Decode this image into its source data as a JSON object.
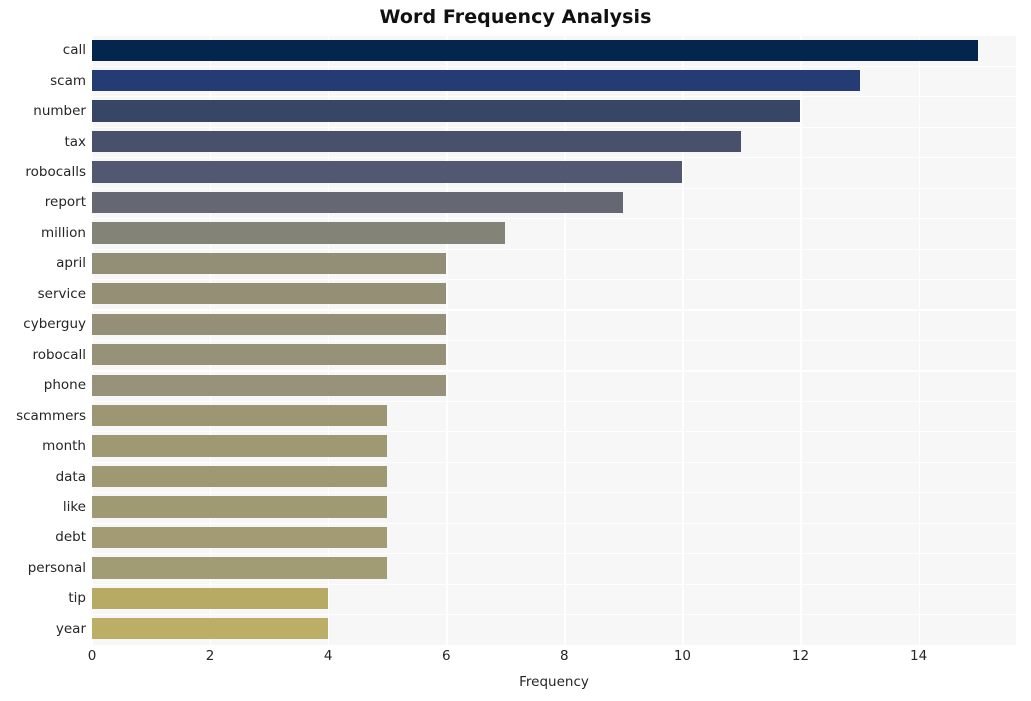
{
  "chart_data": {
    "type": "bar",
    "orientation": "horizontal",
    "title": "Word Frequency Analysis",
    "xlabel": "Frequency",
    "ylabel": "",
    "categories": [
      "call",
      "scam",
      "number",
      "tax",
      "robocalls",
      "report",
      "million",
      "april",
      "service",
      "cyberguy",
      "robocall",
      "phone",
      "scammers",
      "month",
      "data",
      "like",
      "debt",
      "personal",
      "tip",
      "year"
    ],
    "values": [
      15,
      13,
      12,
      11,
      10,
      9,
      7,
      6,
      6,
      6,
      6,
      6,
      5,
      5,
      5,
      5,
      5,
      5,
      4,
      4
    ],
    "bar_colors": [
      "#04254e",
      "#243c73",
      "#384665",
      "#49506b",
      "#535872",
      "#656873",
      "#848378",
      "#938f77",
      "#958f76",
      "#968f78",
      "#979177",
      "#98927a",
      "#9d9673",
      "#9e9873",
      "#9f9973",
      "#a09a73",
      "#a29b74",
      "#a29c75",
      "#b6aa64",
      "#bcae66"
    ],
    "xlim": [
      0,
      15.65
    ],
    "x_ticks": [
      0,
      2,
      4,
      6,
      8,
      10,
      12,
      14
    ],
    "x_tick_labels": [
      "0",
      "2",
      "4",
      "6",
      "8",
      "10",
      "12",
      "14"
    ],
    "grid": {
      "vertical": true,
      "horizontal": false,
      "color": "#ffffff"
    },
    "plot_background": "#f7f7f7",
    "figure_background": "#ffffff",
    "legend": null,
    "series": [
      {
        "name": "Frequency",
        "values": [
          15,
          13,
          12,
          11,
          10,
          9,
          7,
          6,
          6,
          6,
          6,
          6,
          5,
          5,
          5,
          5,
          5,
          5,
          4,
          4
        ]
      }
    ]
  }
}
